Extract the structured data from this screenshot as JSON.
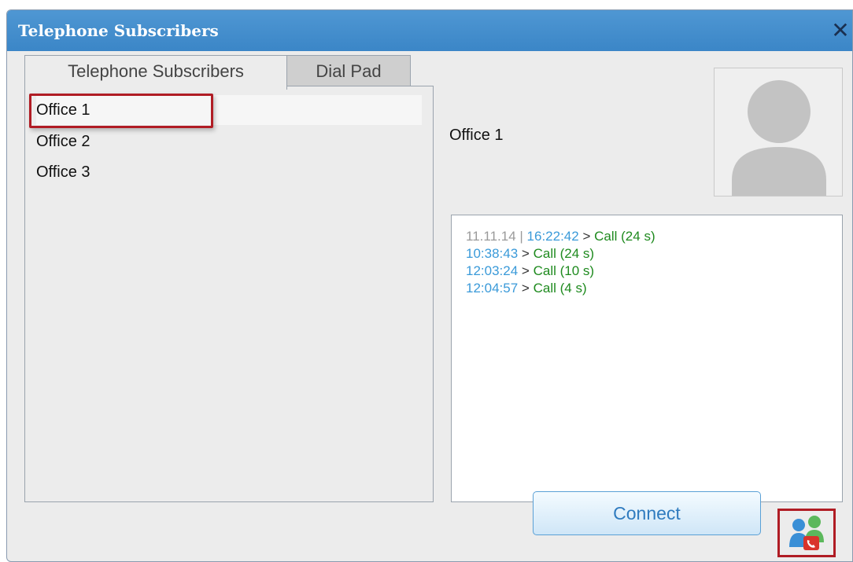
{
  "window": {
    "title": "Telephone Subscribers",
    "close_glyph": "✕"
  },
  "tabs": [
    {
      "label": "Telephone Subscribers",
      "active": true
    },
    {
      "label": "Dial Pad",
      "active": false
    }
  ],
  "subscribers": [
    {
      "name": "Office 1",
      "selected": true
    },
    {
      "name": "Office 2",
      "selected": false
    },
    {
      "name": "Office 3",
      "selected": false
    }
  ],
  "contact": {
    "name": "Office 1",
    "avatar_icon": "person-silhouette-icon"
  },
  "history": {
    "date": "11.11.14",
    "separator": "|",
    "entries": [
      {
        "time": "16:22:42",
        "arrow": ">",
        "event": "Call (24 s)"
      },
      {
        "time": "10:38:43",
        "arrow": ">",
        "event": "Call (24 s)"
      },
      {
        "time": "12:03:24",
        "arrow": ">",
        "event": "Call (10 s)"
      },
      {
        "time": "12:04:57",
        "arrow": ">",
        "event": "Call (4 s)"
      }
    ]
  },
  "buttons": {
    "connect_label": "Connect",
    "call_icon": "users-phone-icon"
  },
  "colors": {
    "titlebar": "#4a92d0",
    "highlight": "#b01c24",
    "time": "#3a9ad9",
    "call": "#1e8a1e"
  }
}
